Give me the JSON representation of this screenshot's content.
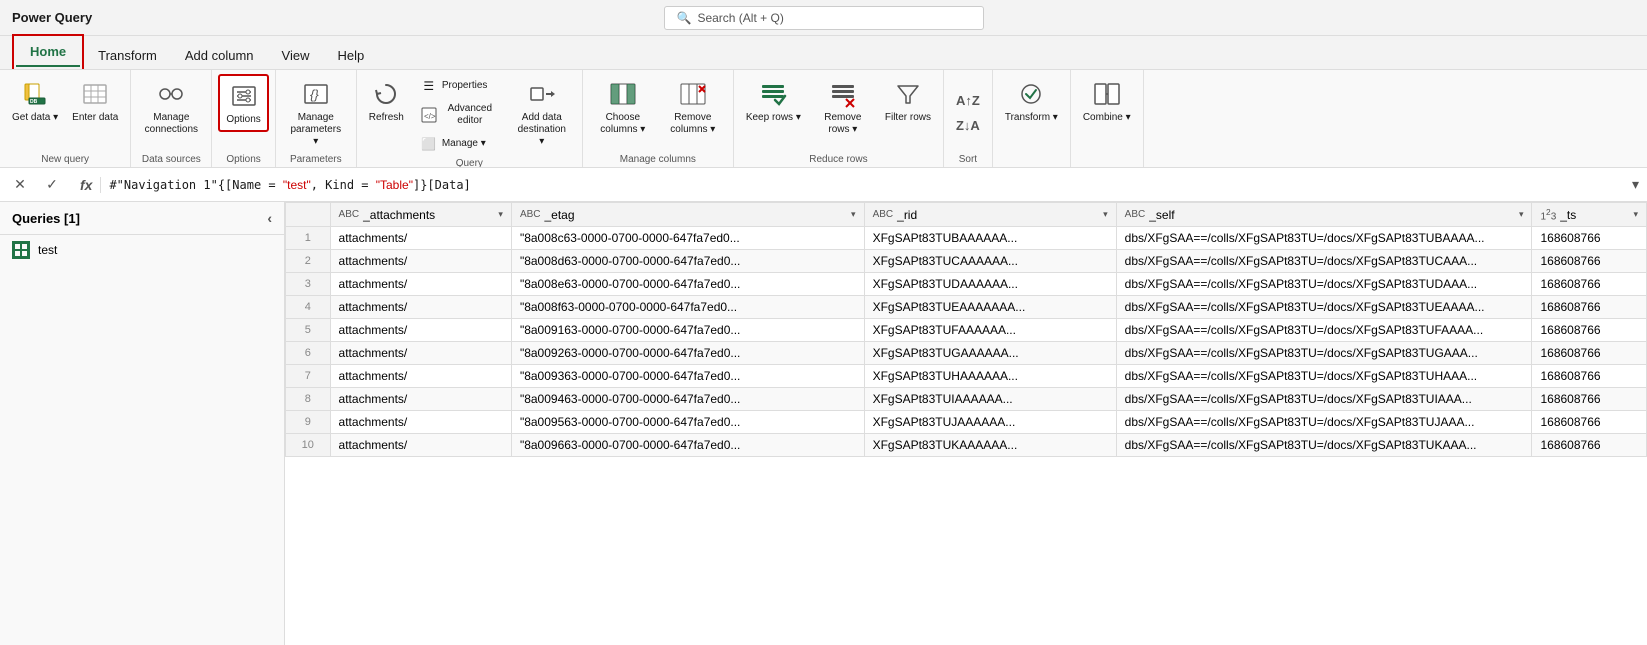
{
  "titleBar": {
    "appName": "Power Query",
    "search": "Search (Alt + Q)"
  },
  "tabs": [
    {
      "id": "home",
      "label": "Home",
      "active": true
    },
    {
      "id": "transform",
      "label": "Transform",
      "active": false
    },
    {
      "id": "add-column",
      "label": "Add column",
      "active": false
    },
    {
      "id": "view",
      "label": "View",
      "active": false
    },
    {
      "id": "help",
      "label": "Help",
      "active": false
    }
  ],
  "ribbon": {
    "groups": [
      {
        "id": "new-query",
        "label": "New query",
        "buttons": [
          {
            "id": "get-data",
            "label": "Get\ndata ∨",
            "icon": "⬇"
          },
          {
            "id": "enter-data",
            "label": "Enter\ndata",
            "icon": "⬜"
          }
        ]
      },
      {
        "id": "data-sources",
        "label": "Data sources",
        "buttons": [
          {
            "id": "manage-connections",
            "label": "Manage\nconnections",
            "icon": "🔌"
          }
        ]
      },
      {
        "id": "options-group",
        "label": "Options",
        "buttons": [
          {
            "id": "options",
            "label": "Options",
            "icon": "⚙",
            "outlined": true
          }
        ]
      },
      {
        "id": "parameters",
        "label": "Parameters",
        "buttons": [
          {
            "id": "manage-parameters",
            "label": "Manage\nparameters ∨",
            "icon": "⬜"
          }
        ]
      },
      {
        "id": "query",
        "label": "Query",
        "buttons": [
          {
            "id": "refresh",
            "label": "Refresh",
            "icon": "↻",
            "small": false
          },
          {
            "id": "properties",
            "label": "Properties",
            "icon": "☰",
            "small": true
          },
          {
            "id": "advanced-editor",
            "label": "Advanced editor",
            "icon": "⬜",
            "small": true
          },
          {
            "id": "manage",
            "label": "Manage ∨",
            "icon": "⬜",
            "small": true
          },
          {
            "id": "add-data-destination",
            "label": "Add data\ndestination ∨",
            "icon": "➡"
          }
        ]
      },
      {
        "id": "manage-columns",
        "label": "Manage columns",
        "buttons": [
          {
            "id": "choose-columns",
            "label": "Choose\ncolumns ∨",
            "icon": "⬛"
          },
          {
            "id": "remove-columns",
            "label": "Remove\ncolumns ∨",
            "icon": "⬛"
          }
        ]
      },
      {
        "id": "reduce-rows",
        "label": "Reduce rows",
        "buttons": [
          {
            "id": "keep-rows",
            "label": "Keep\nrows ∨",
            "icon": "☰"
          },
          {
            "id": "remove-rows",
            "label": "Remove\nrows ∨",
            "icon": "☰"
          },
          {
            "id": "filter-rows",
            "label": "Filter\nrows",
            "icon": "▽"
          }
        ]
      },
      {
        "id": "sort",
        "label": "Sort",
        "buttons": [
          {
            "id": "sort-az",
            "label": "",
            "icon": "AZ↑"
          },
          {
            "id": "sort-za",
            "label": "",
            "icon": "ZA↓"
          }
        ]
      },
      {
        "id": "transform-group",
        "label": "",
        "buttons": [
          {
            "id": "transform-btn",
            "label": "Transform\n∨",
            "icon": "💡"
          }
        ]
      },
      {
        "id": "combine-group",
        "label": "",
        "buttons": [
          {
            "id": "combine",
            "label": "Combine\n∨",
            "icon": "⬛"
          }
        ]
      }
    ]
  },
  "formulaBar": {
    "formula": "#\"Navigation 1\"{[Name = \"test\", Kind = \"Table\"]}[Data]"
  },
  "queriesPanel": {
    "title": "Queries [1]",
    "queries": [
      {
        "id": "test",
        "label": "test"
      }
    ]
  },
  "grid": {
    "columns": [
      {
        "id": "attachments",
        "label": "_attachments",
        "type": "ABC"
      },
      {
        "id": "etag",
        "label": "_etag",
        "type": "ABC"
      },
      {
        "id": "rid",
        "label": "_rid",
        "type": "ABC"
      },
      {
        "id": "self",
        "label": "_self",
        "type": "ABC"
      },
      {
        "id": "ts",
        "label": "_ts",
        "type": "123"
      }
    ],
    "rows": [
      {
        "num": 1,
        "attachments": "attachments/",
        "etag": "\"8a008c63-0000-0700-0000-647fa7ed0...",
        "rid": "XFgSAPt83TUBAAAAAA...",
        "self": "dbs/XFgSAA==/colls/XFgSAPt83TU=/docs/XFgSAPt83TUBAAAA...",
        "ts": "168608766"
      },
      {
        "num": 2,
        "attachments": "attachments/",
        "etag": "\"8a008d63-0000-0700-0000-647fa7ed0...",
        "rid": "XFgSAPt83TUCAAAAAA...",
        "self": "dbs/XFgSAA==/colls/XFgSAPt83TU=/docs/XFgSAPt83TUCAAA...",
        "ts": "168608766"
      },
      {
        "num": 3,
        "attachments": "attachments/",
        "etag": "\"8a008e63-0000-0700-0000-647fa7ed0...",
        "rid": "XFgSAPt83TUDAAAAAA...",
        "self": "dbs/XFgSAA==/colls/XFgSAPt83TU=/docs/XFgSAPt83TUDAAA...",
        "ts": "168608766"
      },
      {
        "num": 4,
        "attachments": "attachments/",
        "etag": "\"8a008f63-0000-0700-0000-647fa7ed0...",
        "rid": "XFgSAPt83TUEAAAAAAA...",
        "self": "dbs/XFgSAA==/colls/XFgSAPt83TU=/docs/XFgSAPt83TUEAAAA...",
        "ts": "168608766"
      },
      {
        "num": 5,
        "attachments": "attachments/",
        "etag": "\"8a009163-0000-0700-0000-647fa7ed0...",
        "rid": "XFgSAPt83TUFAAAAAA...",
        "self": "dbs/XFgSAA==/colls/XFgSAPt83TU=/docs/XFgSAPt83TUFAAAA...",
        "ts": "168608766"
      },
      {
        "num": 6,
        "attachments": "attachments/",
        "etag": "\"8a009263-0000-0700-0000-647fa7ed0...",
        "rid": "XFgSAPt83TUGAAAAAA...",
        "self": "dbs/XFgSAA==/colls/XFgSAPt83TU=/docs/XFgSAPt83TUGAAA...",
        "ts": "168608766"
      },
      {
        "num": 7,
        "attachments": "attachments/",
        "etag": "\"8a009363-0000-0700-0000-647fa7ed0...",
        "rid": "XFgSAPt83TUHAAAAAA...",
        "self": "dbs/XFgSAA==/colls/XFgSAPt83TU=/docs/XFgSAPt83TUHAAA...",
        "ts": "168608766"
      },
      {
        "num": 8,
        "attachments": "attachments/",
        "etag": "\"8a009463-0000-0700-0000-647fa7ed0...",
        "rid": "XFgSAPt83TUIAAAAAA...",
        "self": "dbs/XFgSAA==/colls/XFgSAPt83TU=/docs/XFgSAPt83TUIAAA...",
        "ts": "168608766"
      },
      {
        "num": 9,
        "attachments": "attachments/",
        "etag": "\"8a009563-0000-0700-0000-647fa7ed0...",
        "rid": "XFgSAPt83TUJAAAAAA...",
        "self": "dbs/XFgSAA==/colls/XFgSAPt83TU=/docs/XFgSAPt83TUJAAA...",
        "ts": "168608766"
      },
      {
        "num": 10,
        "attachments": "attachments/",
        "etag": "\"8a009663-0000-0700-0000-647fa7ed0...",
        "rid": "XFgSAPt83TUKAAAAAA...",
        "self": "dbs/XFgSAA==/colls/XFgSAPt83TU=/docs/XFgSAPt83TUKAAA...",
        "ts": "168608766"
      }
    ]
  }
}
